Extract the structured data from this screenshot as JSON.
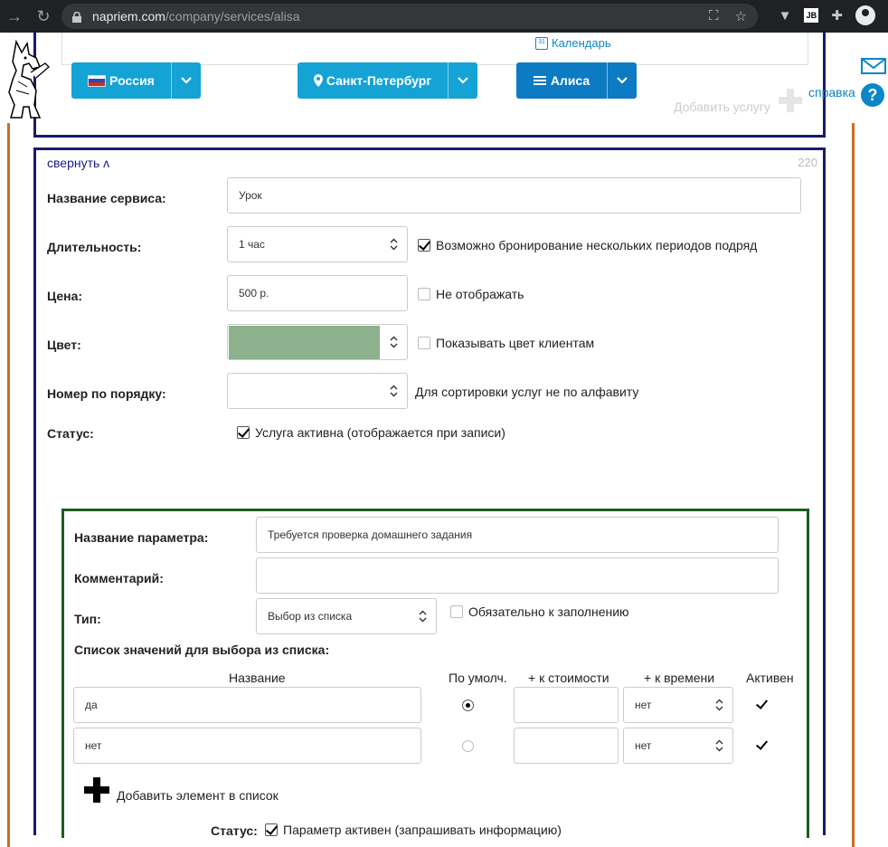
{
  "browser": {
    "url_host": "napriem.com",
    "url_path": "/company/services/alisa"
  },
  "header": {
    "calendar_link": "Календарь",
    "country_button": "Россия",
    "city_button": "Санкт-Петербург",
    "company_button": "Алиса",
    "help_link": "справка",
    "ghost_add_service": "Добавить услугу"
  },
  "service": {
    "collapse_link": "свернуть ʌ",
    "number": "220",
    "name_label": "Название сервиса:",
    "name_value": "Урок",
    "duration_label": "Длительность:",
    "duration_value": "1 час",
    "multi_booking_label": "Возможно бронирование нескольких периодов подряд",
    "multi_booking_checked": true,
    "price_label": "Цена:",
    "price_value": "500 р.",
    "hide_price_label": "Не отображать",
    "hide_price_checked": false,
    "color_label": "Цвет:",
    "color_value": "#8db08d",
    "show_color_label": "Показывать цвет клиентам",
    "show_color_checked": false,
    "order_label": "Номер по порядку:",
    "order_value": "",
    "order_hint": "Для сортировки услуг не по алфавиту",
    "status_label": "Статус:",
    "status_checkbox_label": "Услуга активна (отображается при записи)",
    "status_checked": true
  },
  "parameter": {
    "name_label": "Название параметра:",
    "name_value": "Требуется проверка домашнего задания",
    "comment_label": "Комментарий:",
    "comment_value": "",
    "type_label": "Тип:",
    "type_value": "Выбор из списка",
    "required_label": "Обязательно к заполнению",
    "required_checked": false,
    "list_label": "Список значений для выбора из списка:",
    "columns": {
      "name": "Название",
      "default": "По умолч.",
      "cost": "+ к стоимости",
      "time": "+ к времени",
      "active": "Активен"
    },
    "rows": [
      {
        "name": "да",
        "default": true,
        "cost": "",
        "time": "нет",
        "active": true
      },
      {
        "name": "нет",
        "default": false,
        "cost": "",
        "time": "нет",
        "active": true
      }
    ],
    "add_item_label": "Добавить элемент в список",
    "status_label": "Статус:",
    "status_checkbox_label": "Параметр активен (запрашивать информацию)",
    "status_checked": true
  }
}
